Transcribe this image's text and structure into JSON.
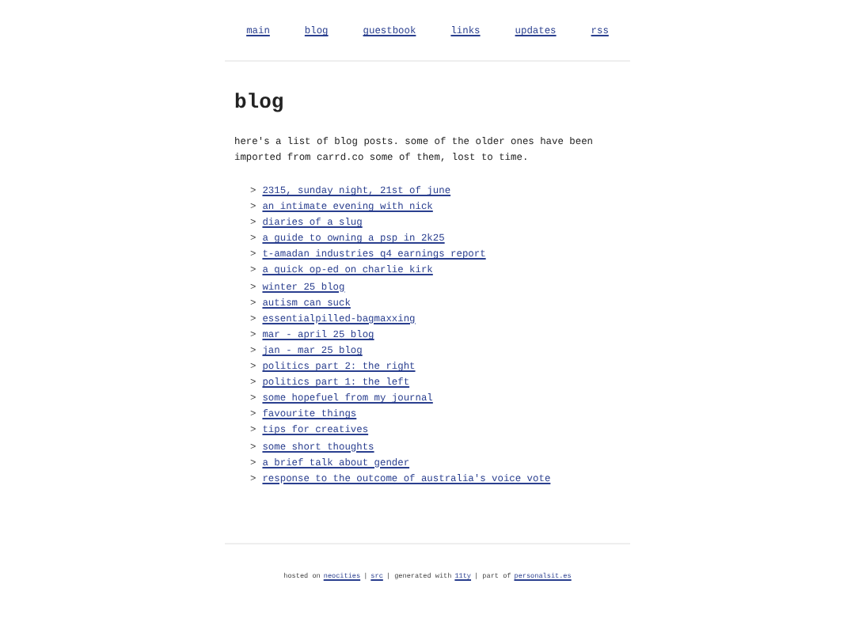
{
  "nav": [
    {
      "label": "main"
    },
    {
      "label": "blog"
    },
    {
      "label": "guestbook"
    },
    {
      "label": "links"
    },
    {
      "label": "updates"
    },
    {
      "label": "rss"
    }
  ],
  "heading": "blog",
  "intro": "here's a list of blog posts. some of the older ones have been imported from carrd.co some of them, lost to time.",
  "posts": [
    {
      "marker": ">",
      "title": "2315, sunday night, 21st of june"
    },
    {
      "marker": ">",
      "title": "an intimate evening with nick"
    },
    {
      "marker": ">",
      "title": "diaries of a slug"
    },
    {
      "marker": ">",
      "title": "a guide to owning a psp in 2k25"
    },
    {
      "marker": ">",
      "title": "t-amadan industries q4 earnings report"
    },
    {
      "marker": ">",
      "title": "a quick op-ed on charlie kirk"
    },
    {
      "marker": ">",
      "title": "winter 25 blog"
    },
    {
      "marker": ">",
      "title": "autism can suck"
    },
    {
      "marker": ">",
      "title": "essentialpilled-bagmaxxing"
    },
    {
      "marker": ">",
      "title": "mar - april 25 blog"
    },
    {
      "marker": ">",
      "title": "jan - mar 25 blog"
    },
    {
      "marker": ">",
      "title": "politics part 2: the right"
    },
    {
      "marker": ">",
      "title": "politics part 1: the left"
    },
    {
      "marker": ">",
      "title": "some hopefuel from my journal"
    },
    {
      "marker": ">",
      "title": "favourite things"
    },
    {
      "marker": ">",
      "title": "tips for creatives"
    },
    {
      "marker": ">",
      "title": "some short thoughts"
    },
    {
      "marker": ">",
      "title": "a brief talk about gender"
    },
    {
      "marker": ">",
      "title": "response to the outcome of australia's voice vote"
    }
  ],
  "footer": [
    {
      "kind": "text",
      "text": "hosted on"
    },
    {
      "kind": "link",
      "text": "neocities"
    },
    {
      "kind": "text",
      "text": "|"
    },
    {
      "kind": "link",
      "text": "src"
    },
    {
      "kind": "text",
      "text": "| generated with"
    },
    {
      "kind": "link",
      "text": "11ty"
    },
    {
      "kind": "text",
      "text": "| part of"
    },
    {
      "kind": "link",
      "text": "personalsit.es"
    }
  ]
}
